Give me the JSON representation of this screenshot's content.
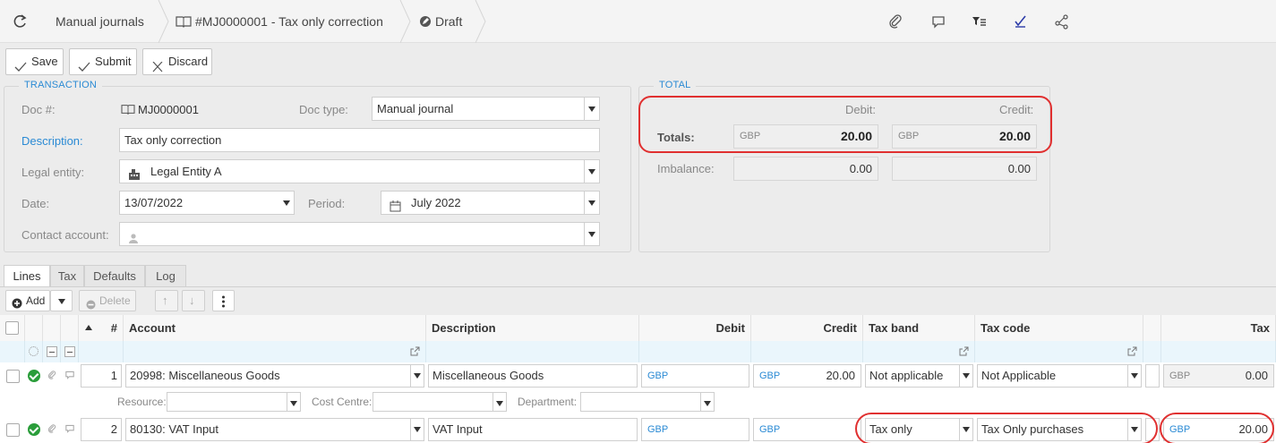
{
  "breadcrumb": {
    "list_label": "Manual journals",
    "doc_label": "#MJ0000001 - Tax only correction",
    "status_label": "Draft"
  },
  "toolbar": {
    "save_label": "Save",
    "submit_label": "Submit",
    "discard_label": "Discard"
  },
  "transaction": {
    "legend": "TRANSACTION",
    "doc_no_label": "Doc #:",
    "doc_no_value": "MJ0000001",
    "doc_type_label": "Doc type:",
    "doc_type_value": "Manual journal",
    "description_label": "Description:",
    "description_value": "Tax only correction",
    "legal_entity_label": "Legal entity:",
    "legal_entity_value": "Legal Entity A",
    "date_label": "Date:",
    "date_value": "13/07/2022",
    "period_label": "Period:",
    "period_value": "July 2022",
    "contact_label": "Contact account:",
    "contact_value": ""
  },
  "total": {
    "legend": "TOTAL",
    "debit_header": "Debit:",
    "credit_header": "Credit:",
    "totals_label": "Totals:",
    "totals_debit_currency": "GBP",
    "totals_debit": "20.00",
    "totals_credit_currency": "GBP",
    "totals_credit": "20.00",
    "imbalance_label": "Imbalance:",
    "imbalance_debit": "0.00",
    "imbalance_credit": "0.00"
  },
  "tabs": [
    {
      "label": "Lines",
      "active": true
    },
    {
      "label": "Tax",
      "active": false
    },
    {
      "label": "Defaults",
      "active": false
    },
    {
      "label": "Log",
      "active": false
    }
  ],
  "grid_toolbar": {
    "add_label": "Add",
    "delete_label": "Delete"
  },
  "grid": {
    "columns": {
      "num": "#",
      "account": "Account",
      "description": "Description",
      "debit": "Debit",
      "credit": "Credit",
      "tax_band": "Tax band",
      "tax_code": "Tax code",
      "tax": "Tax"
    },
    "rows": [
      {
        "num": "1",
        "account": "20998: Miscellaneous Goods",
        "description": "Miscellaneous Goods",
        "debit_currency": "GBP",
        "debit": "",
        "credit_currency": "GBP",
        "credit": "20.00",
        "tax_band": "Not applicable",
        "tax_code": "Not Applicable",
        "tax_currency": "GBP",
        "tax": "0.00"
      },
      {
        "num": "2",
        "account": "80130: VAT Input",
        "description": "VAT Input",
        "debit_currency": "GBP",
        "debit": "",
        "credit_currency": "GBP",
        "credit": "",
        "tax_band": "Tax only",
        "tax_code": "Tax Only purchases",
        "tax_currency": "GBP",
        "tax": "20.00"
      }
    ],
    "sub_row": {
      "resource_label": "Resource:",
      "cost_centre_label": "Cost Centre:",
      "department_label": "Department:"
    }
  },
  "colors": {
    "accent_blue": "#2a8ad4",
    "success_green": "#2a9d3a",
    "highlight_red": "#e03030"
  }
}
